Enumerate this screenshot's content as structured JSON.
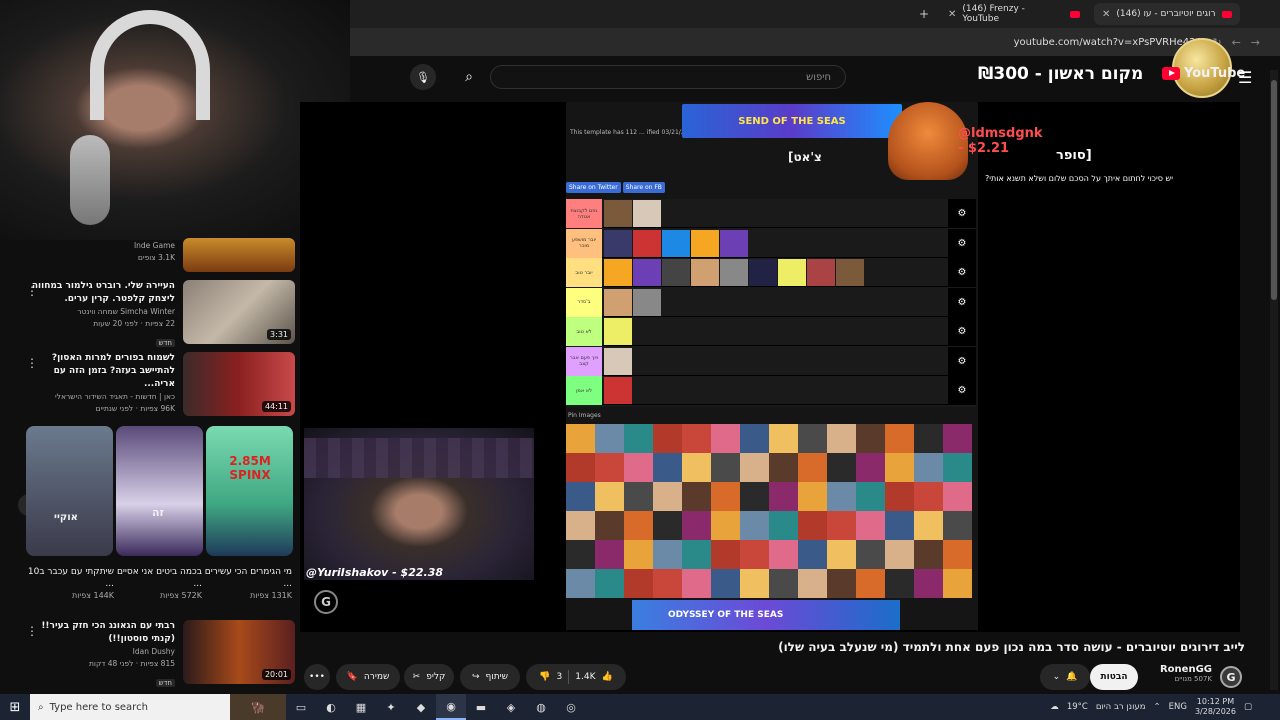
{
  "browser": {
    "tabs": [
      {
        "label": "(146) לייב דירוגים יוטיוברים - עו",
        "active": true
      },
      {
        "label": "(146) Frenzy - YouTube",
        "active": false
      }
    ],
    "new_tab": "+",
    "url": "youtube.com/watch?v=xPsPVRHe42A"
  },
  "header": {
    "search_placeholder": "חיפוש",
    "promo_text": "מקום ראשון - ₪300",
    "logo_text": "YouTube",
    "menu_icon": "hamburger-icon"
  },
  "sidebar": {
    "recs": [
      {
        "title": "",
        "channel": "Inde Game",
        "meta": "3.1K צופים",
        "duration": "",
        "badge": ""
      },
      {
        "title": "העיירה שלי. רוברט גילמור במחווה ליצחק קלפטר. קרין ערים.",
        "channel": "Simcha Winter שמחה ווינטר",
        "meta": "22 צפיות · לפני 20 שעות",
        "duration": "3:31",
        "badge": "חדש"
      },
      {
        "title": "לשמוח בפורים למרות האסון? להתיישב בעזה? בזמן הזה עם אריה...",
        "channel": "כאן | חדשות - תאגיד השידור הישראלי",
        "meta": "96K צפיות · לפני שנתיים",
        "duration": "44:11",
        "badge": ""
      },
      {
        "title": "רבתי עם הגאונג הכי חזק בעיר!! (קנתי סוסטון!!)",
        "channel": "Idan Dushy",
        "meta": "815 צפיות · לפני 48 דקות",
        "duration": "20:01",
        "badge": "חדש"
      }
    ],
    "shorts": [
      {
        "title": "מי הגימרים הכי עשירים ...",
        "views": "131K צפיות"
      },
      {
        "title": "בכמה ביטים אני אסיים ...",
        "views": "572K צפיות"
      },
      {
        "title": "שיתקתי עם עכבר ב10 ...",
        "views": "144K צפיות"
      }
    ],
    "short_overlays": [
      "אוקיי",
      "זה",
      "2.85M SPINX"
    ]
  },
  "player": {
    "ad_top": "SEND OF THE SEAS",
    "ad_bottom": "ODYSSEY OF THE SEAS",
    "donation_name": "@ldmsdgnk - $2.21",
    "donation_prefix": "סופר]",
    "overlay_chat": "[צ'אט",
    "overlay_caption": "יש סיכוי לחתום איתך על הסכם שלום ושלא תשנא אותי?",
    "share_twitter": "Share on Twitter",
    "share_fb": "Share on FB",
    "template_text": "This template has 112 ... ified 03/21/2026",
    "pin_images": "Pin Images",
    "cam2_caption": "@YuriIshakov - $22.38",
    "tier_labels": [
      "גוזם לקבוצת אגודה",
      "יובר מושפע מוכר",
      "יובר טוב",
      "ב'סדר",
      "לא טוב",
      "ויוך פעם אבר קצב",
      "לא אמן"
    ],
    "tier_colors": [
      "#ff7f7f",
      "#ffbf7f",
      "#ffdf7f",
      "#ffff7f",
      "#bfff7f",
      "#e0a0ff",
      "#7fff7f"
    ]
  },
  "video": {
    "title": "לייב דירוגים יוטיוברים - עושה סדר במה נכון פעם אחת ולתמיד (מי שנעלב בעיה שלו)",
    "channel": "RonenGG",
    "subs": "507K מנויים",
    "subscribe_label": "הבטות",
    "likes": "1.4K",
    "dislikes": "3",
    "share_label": "שיתוף",
    "clip_label": "קליפ",
    "save_label": "שמירה",
    "more_label": "•••"
  },
  "taskbar": {
    "search_placeholder": "Type here to search",
    "weather": "19°C",
    "weather_text": "מעונן רב היום",
    "lang": "ENG",
    "time": "10:12 PM",
    "date": "3/28/2026"
  }
}
